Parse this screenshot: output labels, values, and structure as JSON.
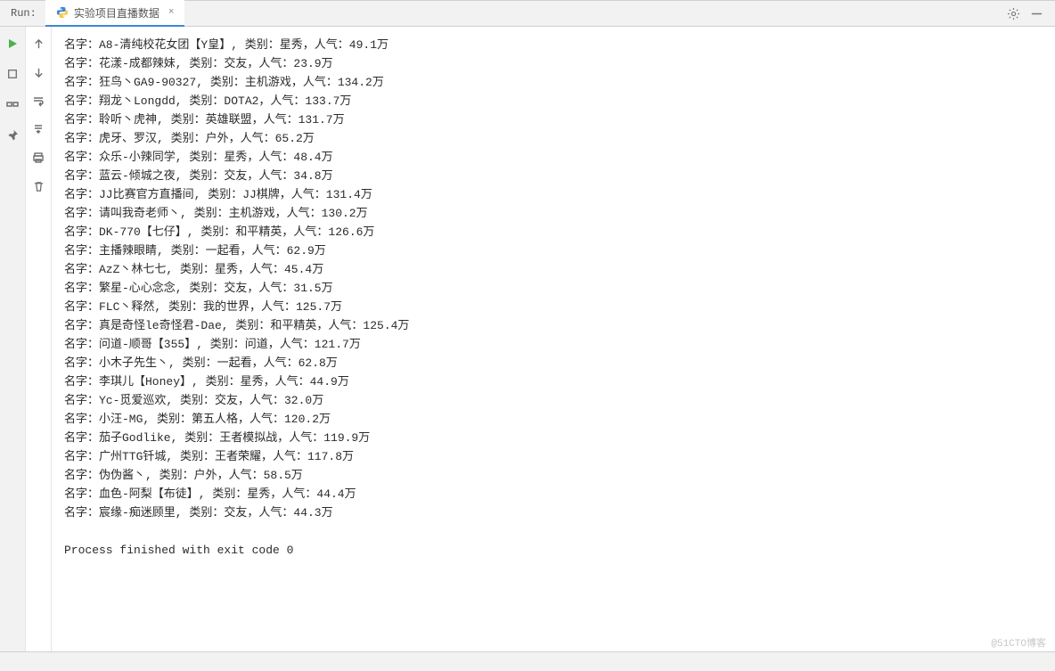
{
  "tabbar": {
    "run_label": "Run:",
    "file_label": "实验项目直播数据",
    "close_glyph": "×"
  },
  "console": {
    "lines": [
      "名字：A8-清纯校花女团【Y皇】, 类别：星秀，人气：49.1万",
      "名字：花漾-成都辣妹, 类别：交友，人气：23.9万",
      "名字：狂鸟丶GA9-90327, 类别：主机游戏，人气：134.2万",
      "名字：翔龙丶Longdd, 类别：DOTA2，人气：133.7万",
      "名字：聆听丶虎神, 类别：英雄联盟，人气：131.7万",
      "名字：虎牙、罗汉, 类别：户外，人气：65.2万",
      "名字：众乐-小辣同学, 类别：星秀，人气：48.4万",
      "名字：蓝云-倾城之夜, 类别：交友，人气：34.8万",
      "名字：JJ比赛官方直播间, 类别：JJ棋牌，人气：131.4万",
      "名字：请叫我奇老师丶, 类别：主机游戏，人气：130.2万",
      "名字：DK-770【七仔】, 类别：和平精英，人气：126.6万",
      "名字：主播辣眼睛, 类别：一起看，人气：62.9万",
      "名字：AzZ丶林七七, 类别：星秀，人气：45.4万",
      "名字：繁星-心心念念, 类别：交友，人气：31.5万",
      "名字：FLC丶释然, 类别：我的世界，人气：125.7万",
      "名字：真是奇怪le奇怪君-Dae, 类别：和平精英，人气：125.4万",
      "名字：问道-顺哥【355】, 类别：问道，人气：121.7万",
      "名字：小木子先生丶, 类别：一起看，人气：62.8万",
      "名字：李琪儿【Honey】, 类别：星秀，人气：44.9万",
      "名字：Yc-觅爱巡欢, 类别：交友，人气：32.0万",
      "名字：小汪-MG, 类别：第五人格，人气：120.2万",
      "名字：茄子Godlike, 类别：王者模拟战，人气：119.9万",
      "名字：广州TTG钎城, 类别：王者荣耀，人气：117.8万",
      "名字：伪伪酱丶, 类别：户外，人气：58.5万",
      "名字：血色-阿梨【布徒】, 类别：星秀，人气：44.4万",
      "名字：宸缘-痴迷顾里, 类别：交友，人气：44.3万"
    ],
    "exit_line": "Process finished with exit code 0"
  },
  "watermark": "@51CTO博客"
}
